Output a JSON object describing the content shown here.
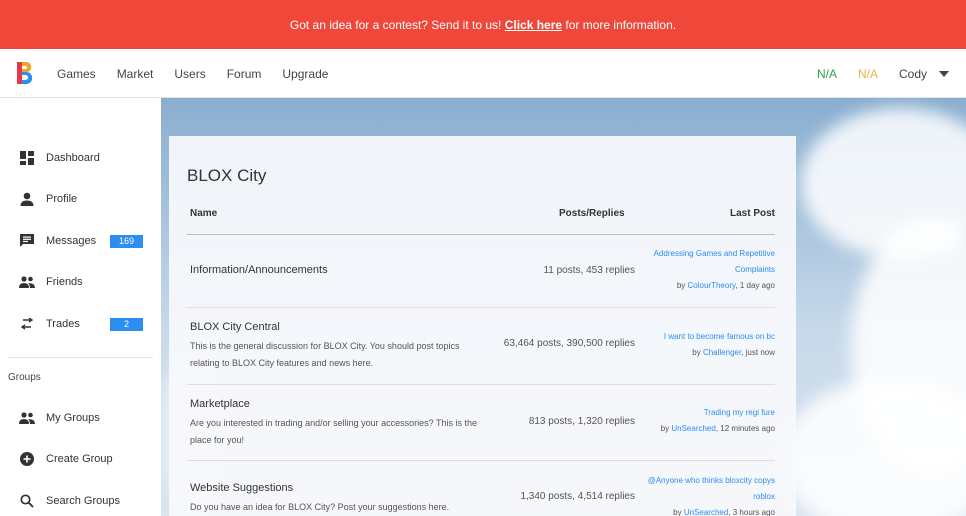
{
  "banner": {
    "text_before": "Got an idea for a contest? Send it to us!",
    "link": "Click here",
    "text_after": "for more information.",
    "color": "#ef473a"
  },
  "nav": {
    "logo_icon": "blox-city-logo",
    "links": [
      "Games",
      "Market",
      "Users",
      "Forum",
      "Upgrade"
    ],
    "currency_a": "N/A",
    "currency_b": "N/A",
    "username": "Cody"
  },
  "sidebar": {
    "items": [
      {
        "label": "Dashboard",
        "icon": "dashboard-icon"
      },
      {
        "label": "Profile",
        "icon": "person-icon"
      },
      {
        "label": "Messages",
        "icon": "message-icon",
        "badge": "169"
      },
      {
        "label": "Friends",
        "icon": "friends-icon"
      },
      {
        "label": "Trades",
        "icon": "trade-arrows-icon",
        "badge": "2"
      }
    ],
    "groups_heading": "Groups",
    "group_items": [
      {
        "label": "My Groups",
        "icon": "groups-icon"
      },
      {
        "label": "Create Group",
        "icon": "plus-circle-icon"
      },
      {
        "label": "Search Groups",
        "icon": "search-icon"
      }
    ]
  },
  "forum": {
    "title": "BLOX City",
    "columns": {
      "name": "Name",
      "posts": "Posts/Replies",
      "last": "Last Post"
    },
    "rows": [
      {
        "name": "Information/Announcements",
        "desc": "",
        "stats": "11 posts, 453 replies",
        "last_title": "Addressing Games and Repetitive Complaints",
        "by": "by",
        "last_user": "ColourTheory",
        "last_time": ", 1 day ago"
      },
      {
        "name": "BLOX City Central",
        "desc": "This is the general discussion for BLOX City. You should post topics relating to BLOX City features and news here.",
        "stats": "63,464 posts, 390,500 replies",
        "last_title": "I want to become famous on bc",
        "by": "by",
        "last_user": "Challenger",
        "last_time": ", just now"
      },
      {
        "name": "Marketplace",
        "desc": "Are you interested in trading and/or selling your accessories? This is the place for you!",
        "stats": "813 posts, 1,320 replies",
        "last_title": "Trading my regi fure",
        "by": "by",
        "last_user": "UnSearched",
        "last_time": ", 12 minutes ago"
      },
      {
        "name": "Website Suggestions",
        "desc": "Do you have an idea for BLOX City? Post your suggestions here.",
        "stats": "1,340 posts, 4,514 replies",
        "last_title": "@Anyone who thinks bloxcity copys roblox",
        "by": "by",
        "last_user": "UnSearched",
        "last_time": ", 3 hours ago"
      }
    ]
  }
}
